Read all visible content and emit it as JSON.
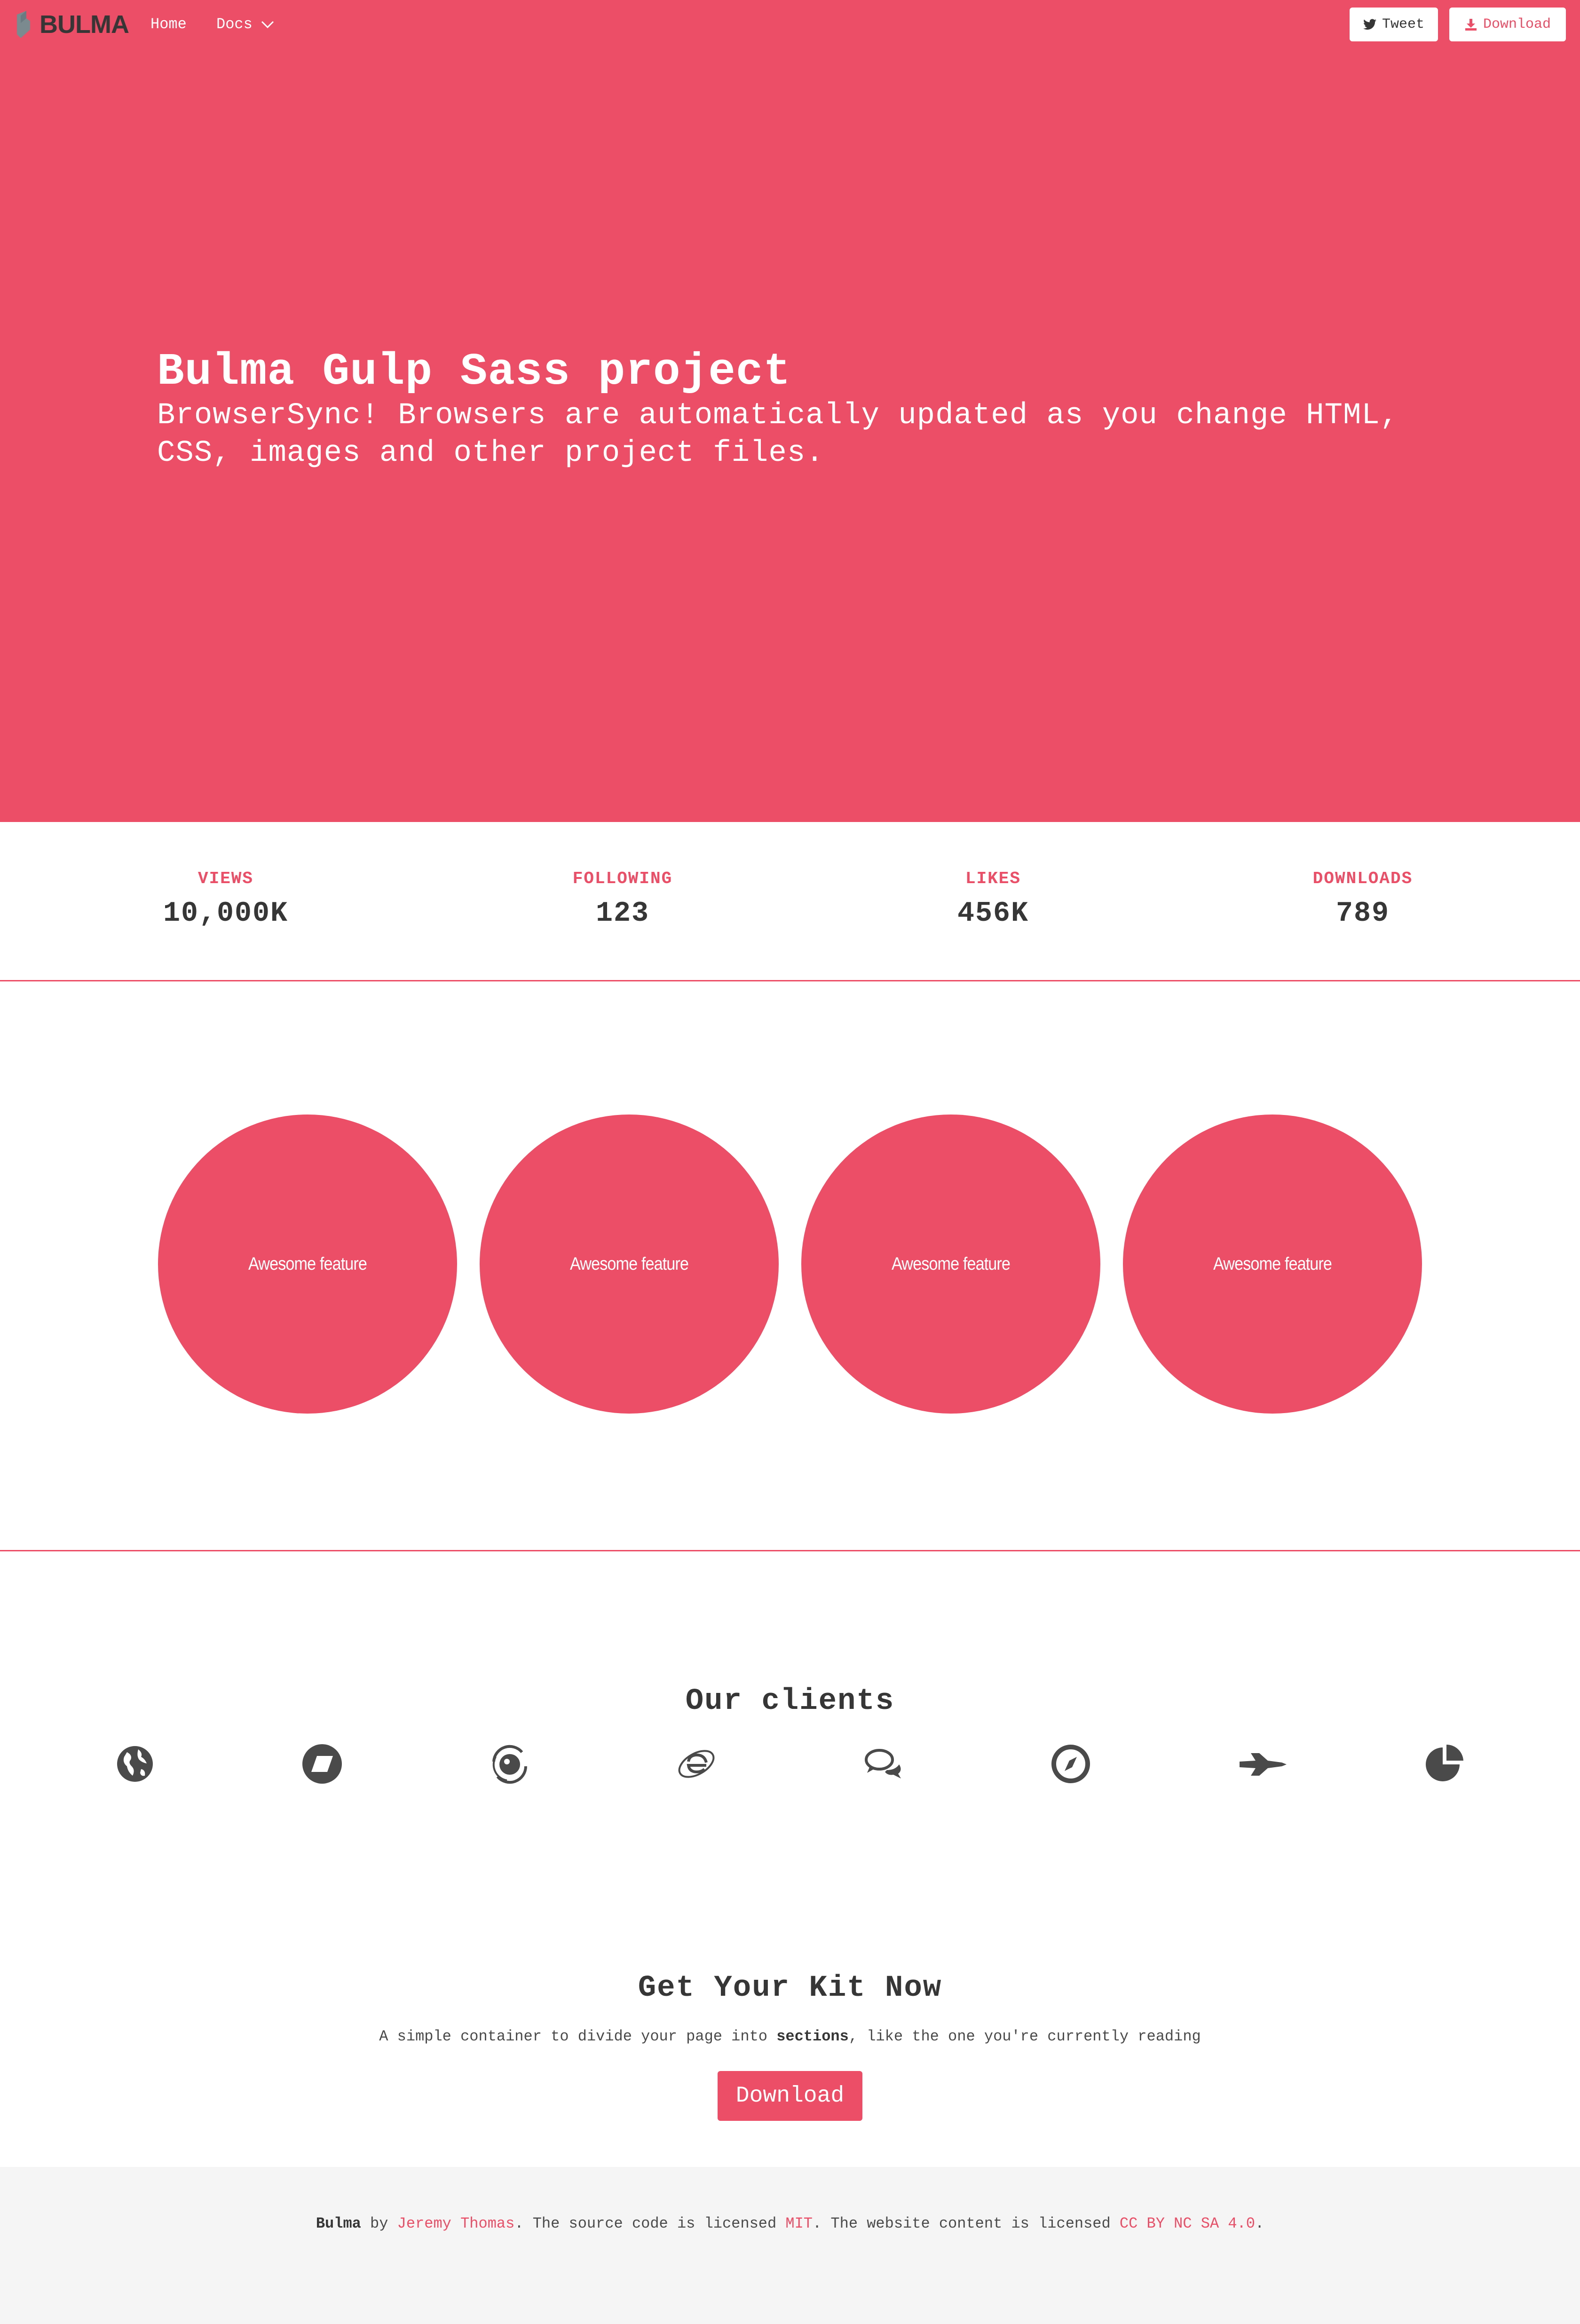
{
  "nav": {
    "brand": "BULMA",
    "home": "Home",
    "docs": "Docs",
    "tweet": "Tweet",
    "download": "Download"
  },
  "hero": {
    "title": "Bulma Gulp Sass project",
    "subtitle": "BrowserSync! Browsers are automatically updated as you change HTML, CSS, images and other project files."
  },
  "stats": [
    {
      "label": "VIEWS",
      "value": "10,000K"
    },
    {
      "label": "FOLLOWING",
      "value": "123"
    },
    {
      "label": "LIKES",
      "value": "456K"
    },
    {
      "label": "DOWNLOADS",
      "value": "789"
    }
  ],
  "features": [
    "Awesome feature",
    "Awesome feature",
    "Awesome feature",
    "Awesome feature"
  ],
  "clients": {
    "title": "Our clients",
    "icons": [
      "globe-icon",
      "parallelogram-icon",
      "orbit-icon",
      "internet-explorer-icon",
      "chat-bubbles-icon",
      "compass-icon",
      "space-shuttle-icon",
      "pie-chart-icon"
    ]
  },
  "kit": {
    "title": "Get Your Kit Now",
    "text_before": "A simple container to divide your page into ",
    "text_bold": "sections",
    "text_after": ", like the one you're currently reading",
    "button": "Download"
  },
  "footer": {
    "brand": "Bulma",
    "by": " by ",
    "author": "Jeremy Thomas",
    "mid1": ". The source code is licensed ",
    "license_code": "MIT",
    "mid2": ". The website content is licensed ",
    "license_content": "CC BY NC SA 4.0",
    "end": "."
  },
  "colors": {
    "primary": "#eb4e66",
    "dark": "#363636",
    "footer_bg": "#f5f5f5"
  }
}
